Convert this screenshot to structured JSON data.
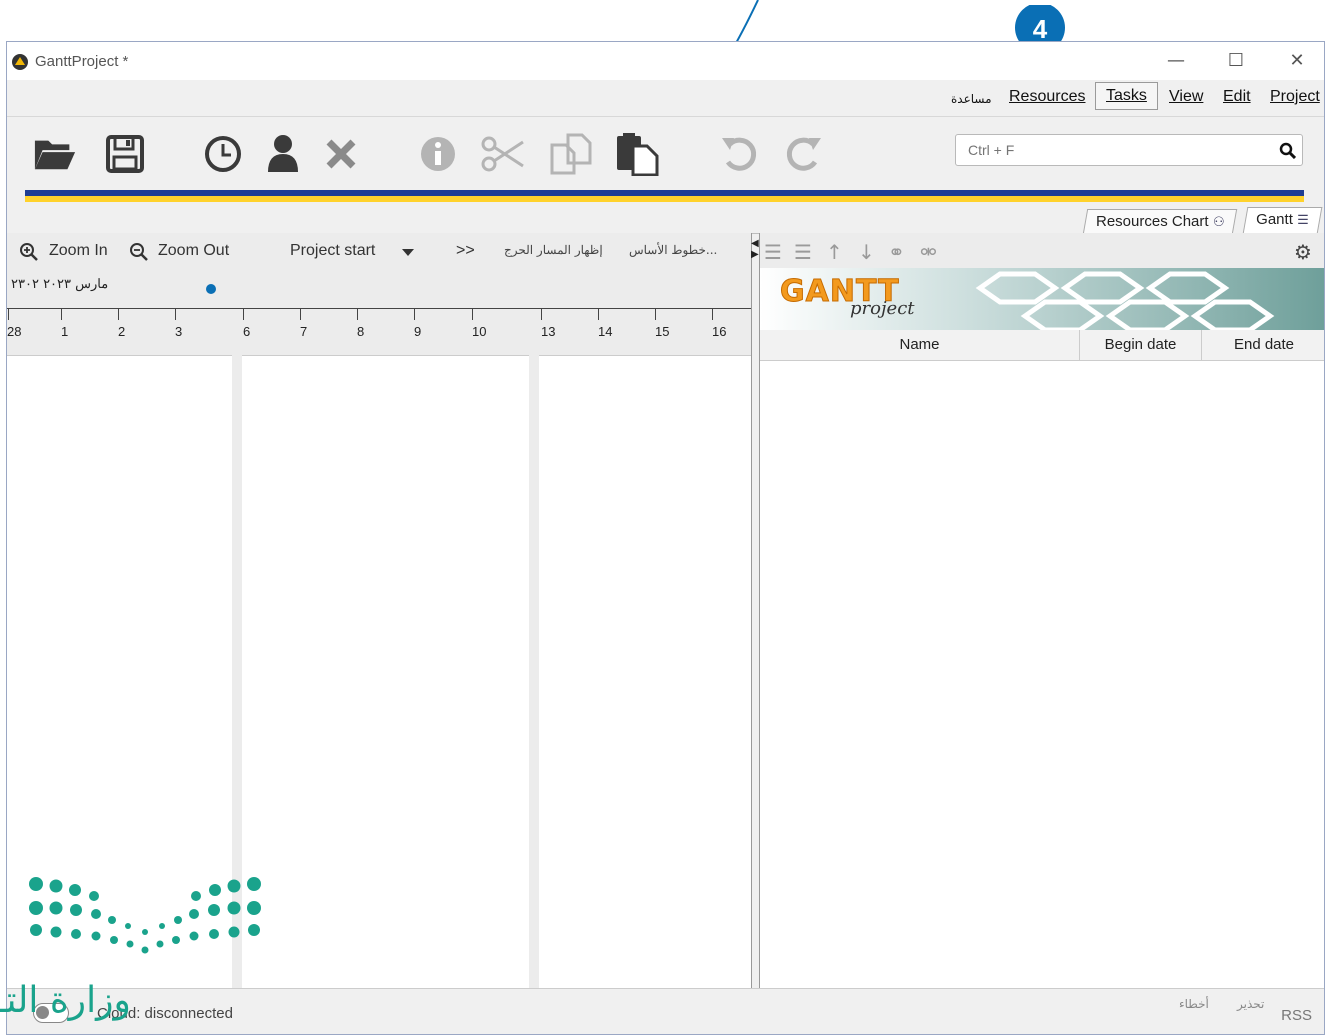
{
  "window": {
    "title": "GanttProject *",
    "controls": [
      "—",
      "☐",
      "✕"
    ]
  },
  "marker": {
    "number": "4"
  },
  "menu": {
    "help": "مساعدة",
    "resources": "Resources",
    "tasks": "Tasks",
    "view": "View",
    "edit": "Edit",
    "project": "Project"
  },
  "toolbar": {
    "search_placeholder": "Ctrl + F",
    "icons": [
      "open-folder-icon",
      "save-icon",
      "clock-icon",
      "person-icon",
      "delete-icon",
      "info-icon",
      "cut-icon",
      "copy-icon",
      "paste-icon",
      "undo-icon",
      "redo-icon"
    ]
  },
  "tabs": {
    "resources_chart": "Resources Chart",
    "gantt": "Gantt"
  },
  "chart_toolbar": {
    "zoom_in": "Zoom In",
    "zoom_out": "Zoom Out",
    "project_start": "Project start",
    "more": ">>",
    "critical_path": "إظهار المسار الحرج",
    "baselines": "خطوط الأساس..."
  },
  "timeline": {
    "month_label": "مارس ٢٠٢٣   ٢٣٠٢",
    "days": [
      "28",
      "1",
      "2",
      "3",
      "6",
      "7",
      "8",
      "9",
      "10",
      "13",
      "14",
      "15",
      "16"
    ]
  },
  "task_table": {
    "logo_text": "GANTT",
    "logo_sub": "project",
    "columns": {
      "name": "Name",
      "begin": "Begin date",
      "end": "End date"
    }
  },
  "status": {
    "cloud": "Cloud: disconnected",
    "errors": "أخطاء",
    "warnings": "تحذير",
    "rss": "RSS"
  },
  "ministry": {
    "text": "وزارة التـ"
  },
  "colors": {
    "marker_blue": "#0a6fb5",
    "stripe_blue": "#1f3e93",
    "stripe_yellow": "#ffd22b",
    "logo_green": "#1aa38c"
  }
}
